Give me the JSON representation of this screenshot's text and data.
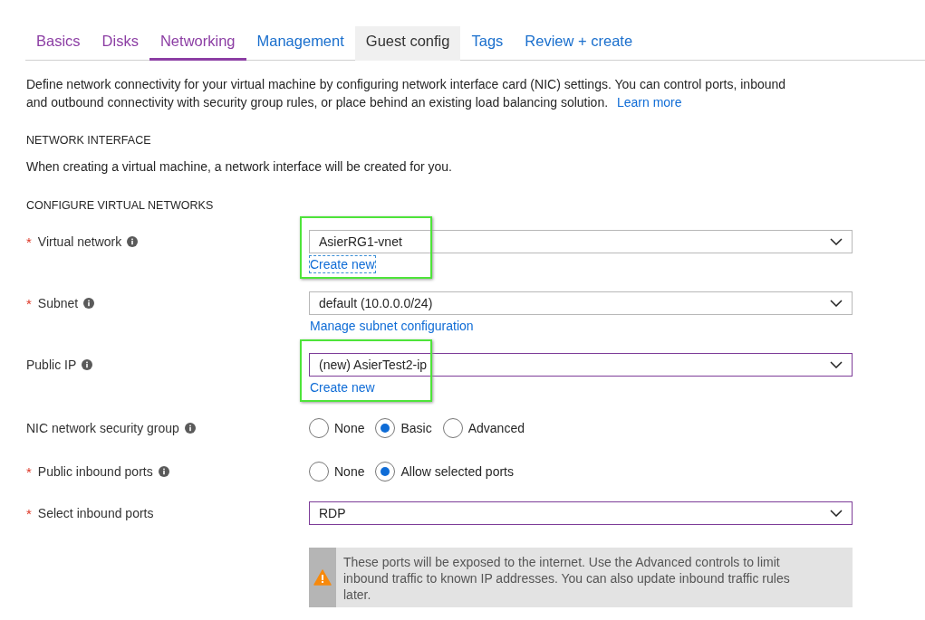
{
  "tabs": [
    {
      "label": "Basics",
      "selected": false,
      "visited": true,
      "hovered": false
    },
    {
      "label": "Disks",
      "selected": false,
      "visited": true,
      "hovered": false
    },
    {
      "label": "Networking",
      "selected": true,
      "visited": true,
      "hovered": false
    },
    {
      "label": "Management",
      "selected": false,
      "visited": false,
      "hovered": false
    },
    {
      "label": "Guest config",
      "selected": false,
      "visited": false,
      "hovered": true
    },
    {
      "label": "Tags",
      "selected": false,
      "visited": false,
      "hovered": false
    },
    {
      "label": "Review + create",
      "selected": false,
      "visited": false,
      "hovered": false
    }
  ],
  "description": {
    "text": "Define network connectivity for your virtual machine by configuring network interface card (NIC) settings. You can control ports, inbound and outbound connectivity with security group rules, or place behind an existing load balancing solution.",
    "link": "Learn more"
  },
  "network_interface": {
    "heading": "NETWORK INTERFACE",
    "text": "When creating a virtual machine, a network interface will be created for you."
  },
  "configure": {
    "heading": "CONFIGURE VIRTUAL NETWORKS"
  },
  "fields": [
    {
      "kind": "dropdown",
      "required_mark": "*",
      "label": "Virtual network",
      "info": true,
      "value": "AsierRG1-vnet",
      "focused": false,
      "link": "Create new",
      "link_focused": true,
      "highlighted": true
    },
    {
      "kind": "dropdown",
      "required_mark": "*",
      "label": "Subnet",
      "info": true,
      "value": "default (10.0.0.0/24)",
      "focused": false,
      "link": "Manage subnet configuration",
      "link_focused": false
    },
    {
      "kind": "dropdown",
      "label": "Public IP",
      "info": true,
      "value": "(new) AsierTest2-ip",
      "focused": true,
      "link": "Create new",
      "link_focused": false,
      "highlighted": true
    },
    {
      "kind": "radio",
      "label": "NIC network security group",
      "info": true,
      "options": [
        {
          "label": "None",
          "selected": false
        },
        {
          "label": "Basic",
          "selected": true
        },
        {
          "label": "Advanced",
          "selected": false
        }
      ]
    },
    {
      "kind": "radio",
      "required_mark": "*",
      "label": "Public inbound ports",
      "info": true,
      "options": [
        {
          "label": "None",
          "selected": false
        },
        {
          "label": "Allow selected ports",
          "selected": true
        }
      ]
    },
    {
      "kind": "dropdown",
      "required_mark": "*",
      "label": "Select inbound ports",
      "value": "RDP",
      "focused": true
    }
  ],
  "warning": {
    "text": "These ports will be exposed to the internet. Use the Advanced controls to limit inbound traffic to known IP addresses. You can also update inbound traffic rules later."
  }
}
